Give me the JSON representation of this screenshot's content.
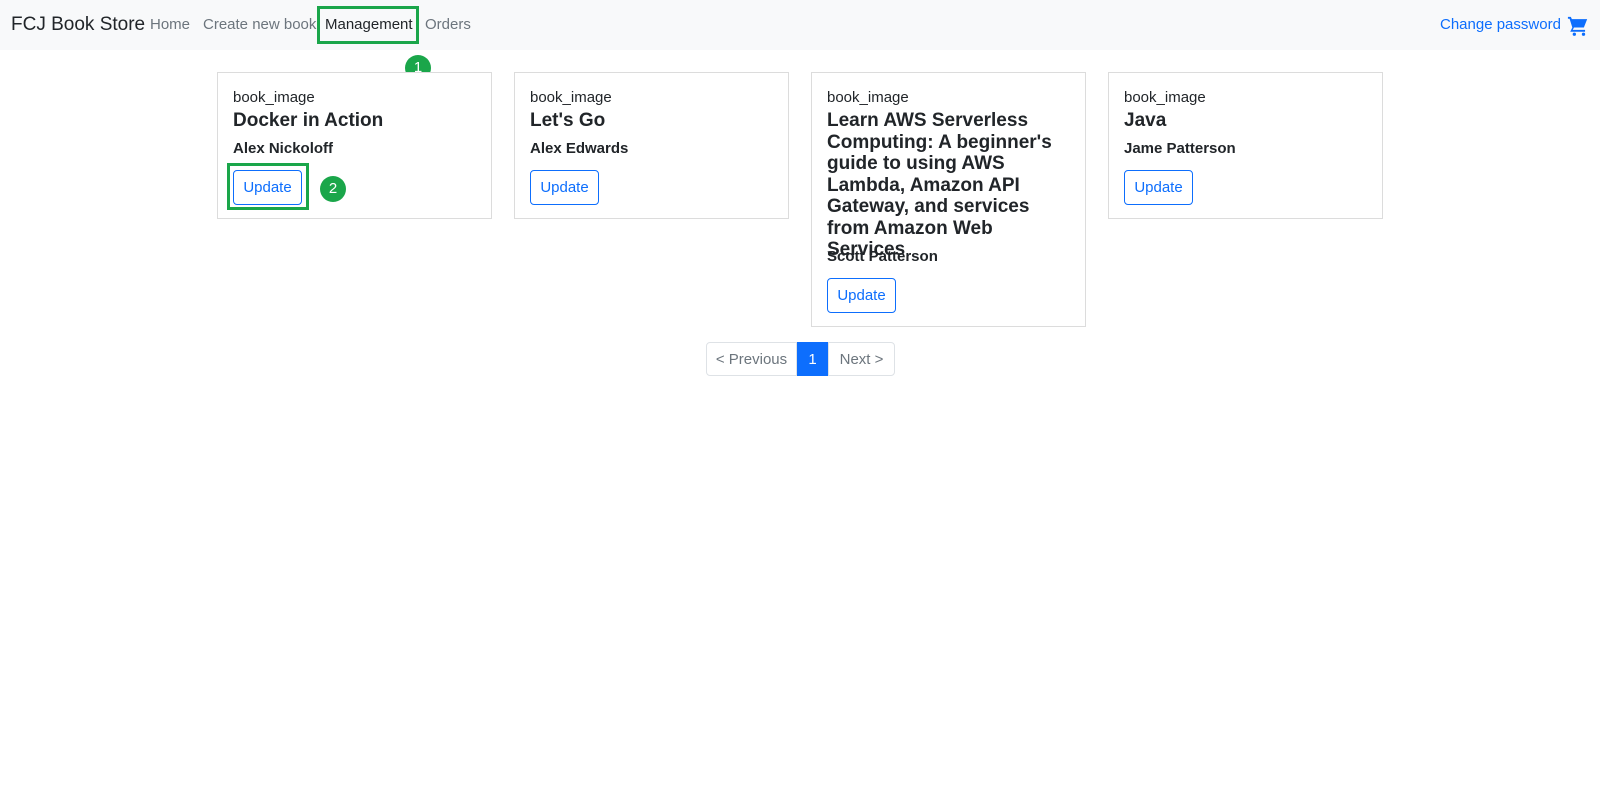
{
  "navbar": {
    "brand": "FCJ Book Store",
    "links": [
      "Home",
      "Create new book",
      "Management",
      "Orders"
    ],
    "active_link": "Management",
    "right_link": "Change password",
    "cart_icon": "cart-icon"
  },
  "annotations": {
    "marker_1": "1",
    "marker_2": "2"
  },
  "books": [
    {
      "image_alt": "book_image",
      "title": "Docker in Action",
      "author": "Alex Nickoloff",
      "button": "Update"
    },
    {
      "image_alt": "book_image",
      "title": "Let's Go",
      "author": "Alex Edwards",
      "button": "Update"
    },
    {
      "image_alt": "book_image",
      "title": "Learn AWS Serverless Computing: A beginner's guide to using AWS Lambda, Amazon API Gateway, and services from Amazon Web Services",
      "author": "Scott Patterson",
      "button": "Update"
    },
    {
      "image_alt": "book_image",
      "title": "Java",
      "author": "Jame Patterson",
      "button": "Update"
    }
  ],
  "pagination": {
    "previous": "< Previous",
    "current": "1",
    "next": "Next >"
  },
  "colors": {
    "accent": "#0d6efd",
    "highlight": "#1aa64a",
    "navbar_bg": "#f8f9fa"
  }
}
